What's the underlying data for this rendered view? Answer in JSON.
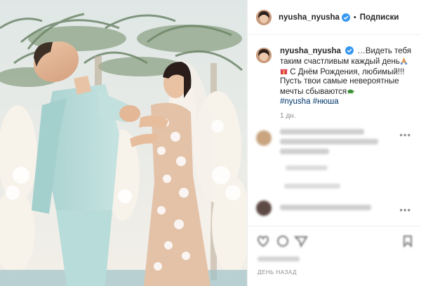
{
  "header": {
    "username": "nyusha_nyusha",
    "separator": "•",
    "follow_label": "Подписки"
  },
  "caption": {
    "username": "nyusha_nyusha",
    "line1": " …Видеть тебя таким счастливым каждый день",
    "line2": " С Днём Рождения, любимый!!! Пусть твои самые невероятные мечты сбываются",
    "hashtags": [
      "#nyusha",
      "#нюша"
    ],
    "age": "1 дн."
  },
  "comments_more": "•••",
  "post_date": "ДЕНЬ НАЗАД",
  "icons": [
    "verified-badge-icon",
    "praying-hands-icon",
    "gift-icon",
    "turtle-icon",
    "more-options-icon",
    "like-icon",
    "comment-icon",
    "share-icon",
    "bookmark-icon"
  ],
  "colors": {
    "accent": "#3897f0",
    "hashtag": "#00376b",
    "muted": "#8e8e8e",
    "border": "#efefef"
  }
}
